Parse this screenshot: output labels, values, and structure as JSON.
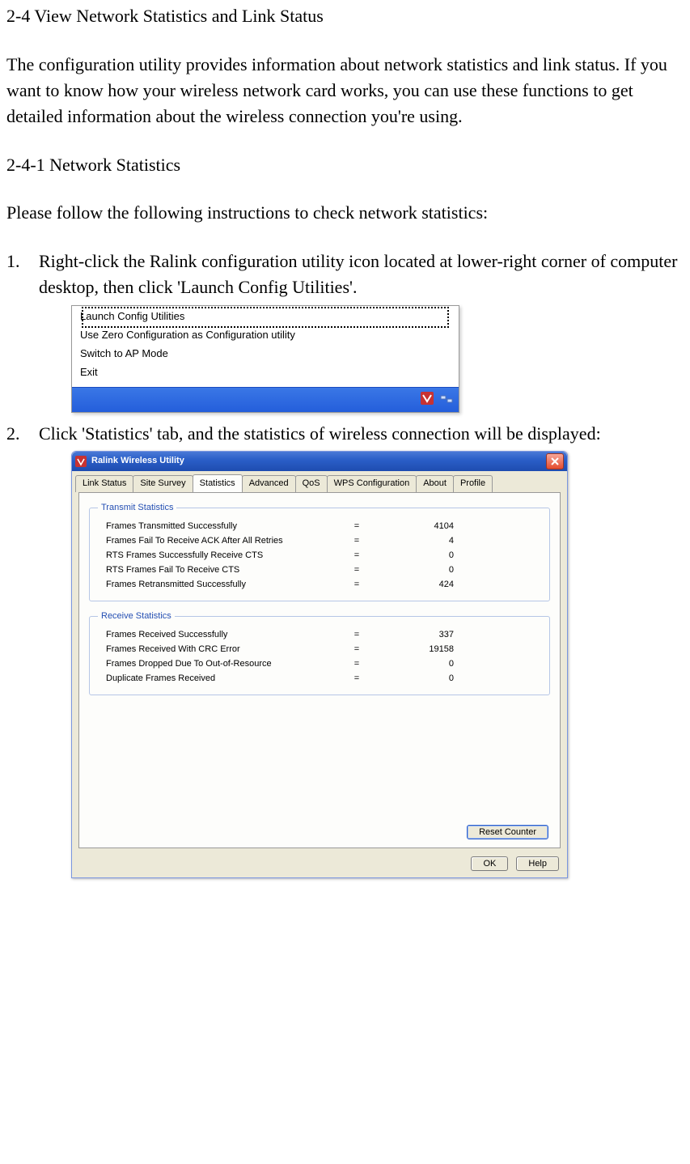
{
  "doc": {
    "section_title": "2-4  View Network Statistics and Link Status",
    "intro_para": "The configuration utility provides information about network statistics and link status. If you want to know how your wireless network card works, you can use these functions to get detailed information about the wireless connection you're using.",
    "subhead": "2-4-1 Network Statistics",
    "lead_in": "Please follow the following instructions to check network statistics:",
    "steps": [
      "Right-click the Ralink configuration utility icon located at lower-right corner of computer desktop, then click 'Launch Config Utilities'.",
      "Click 'Statistics' tab, and the statistics of wireless connection will be displayed:"
    ]
  },
  "context_menu": {
    "items": [
      "Launch Config Utilities",
      "Use Zero Configuration as Configuration utility",
      "Switch to AP Mode",
      "Exit"
    ]
  },
  "window": {
    "title": "Ralink Wireless Utility",
    "tabs": [
      "Link Status",
      "Site Survey",
      "Statistics",
      "Advanced",
      "QoS",
      "WPS Configuration",
      "About",
      "Profile"
    ],
    "active_tab_index": 2,
    "transmit": {
      "legend": "Transmit Statistics",
      "rows": [
        {
          "label": "Frames Transmitted Successfully",
          "value": "4104"
        },
        {
          "label": "Frames Fail To Receive ACK After All Retries",
          "value": "4"
        },
        {
          "label": "RTS Frames Successfully Receive CTS",
          "value": "0"
        },
        {
          "label": "RTS Frames Fail To Receive CTS",
          "value": "0"
        },
        {
          "label": "Frames Retransmitted Successfully",
          "value": "424"
        }
      ]
    },
    "receive": {
      "legend": "Receive Statistics",
      "rows": [
        {
          "label": "Frames Received Successfully",
          "value": "337"
        },
        {
          "label": "Frames Received With CRC Error",
          "value": "19158"
        },
        {
          "label": "Frames Dropped Due To Out-of-Resource",
          "value": "0"
        },
        {
          "label": "Duplicate Frames Received",
          "value": "0"
        }
      ]
    },
    "buttons": {
      "reset": "Reset Counter",
      "ok": "OK",
      "help": "Help"
    }
  }
}
